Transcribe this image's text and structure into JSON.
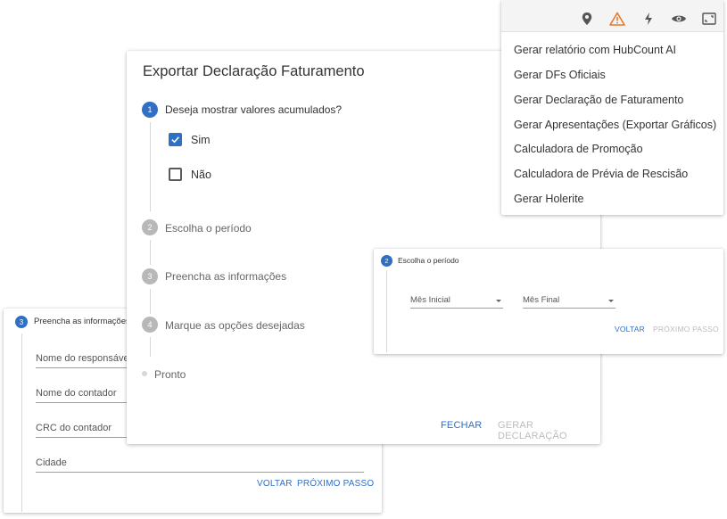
{
  "left_card": {
    "step_number": "3",
    "title": "Preencha as informações",
    "fields": [
      "Nome do responsável",
      "Nome do contador",
      "CRC do contador",
      "Cidade"
    ],
    "back_label": "VOLTAR",
    "next_label": "PRÓXIMO PASSO"
  },
  "main_dialog": {
    "title": "Exportar Declaração Faturamento",
    "steps": [
      {
        "number": "1",
        "label": "Deseja mostrar valores acumulados?",
        "active": true
      },
      {
        "number": "2",
        "label": "Escolha o período",
        "active": false
      },
      {
        "number": "3",
        "label": "Preencha as informações",
        "active": false
      },
      {
        "number": "4",
        "label": "Marque as opções desejadas",
        "active": false
      },
      {
        "number": "",
        "label": "Pronto",
        "active": false
      }
    ],
    "options": [
      {
        "label": "Sim",
        "checked": true
      },
      {
        "label": "Não",
        "checked": false
      }
    ],
    "close_label": "FECHAR",
    "generate_label": "GERAR DECLARAÇÃO"
  },
  "middle_card": {
    "step_number": "2",
    "title": "Escolha o período",
    "start_month_placeholder": "Mês Inicial",
    "end_month_placeholder": "Mês Final",
    "back_label": "VOLTAR",
    "next_label": "PRÓXIMO PASSO"
  },
  "menu": {
    "toolbar_icons": [
      "map-pin-icon",
      "warning-icon",
      "lightning-icon",
      "eye-icon",
      "fullscreen-icon"
    ],
    "items": [
      "Gerar relatório com HubCount AI",
      "Gerar DFs Oficiais",
      "Gerar Declaração de Faturamento",
      "Gerar Apresentações (Exportar Gráficos)",
      "Calculadora de Promoção",
      "Calculadora de Prévia de Rescisão",
      "Gerar Holerite"
    ]
  },
  "colors": {
    "accent": "#2f6fc4",
    "warning": "#e8772a",
    "disabled": "#bdbdbd"
  }
}
